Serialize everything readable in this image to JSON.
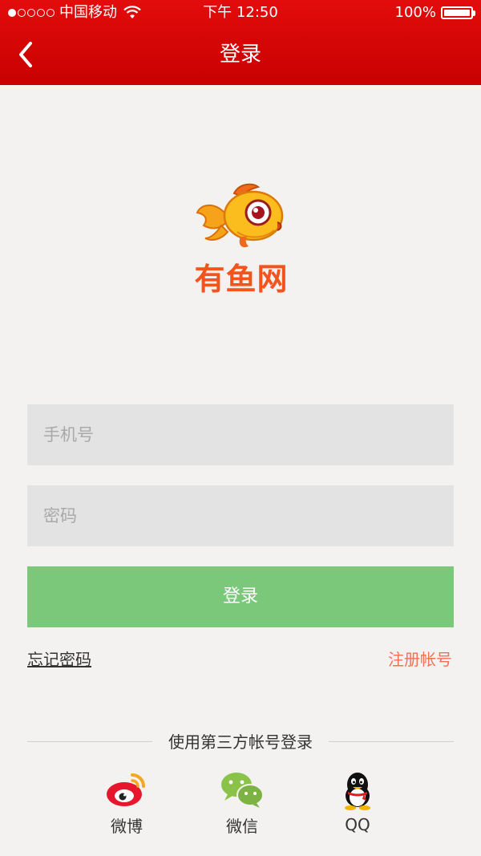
{
  "status_bar": {
    "carrier": "中国移动",
    "time": "下午 12:50",
    "battery": "100%",
    "signal_bars_filled": 1,
    "signal_bars_total": 5
  },
  "nav": {
    "title": "登录",
    "back_icon": "chevron-left-icon"
  },
  "logo": {
    "text": "有鱼网",
    "icon": "fish-mascot-icon",
    "color": "#f3541e"
  },
  "form": {
    "phone_placeholder": "手机号",
    "password_placeholder": "密码",
    "login_label": "登录",
    "forgot_label": "忘记密码",
    "register_label": "注册帐号"
  },
  "third_party": {
    "title": "使用第三方帐号登录",
    "items": [
      {
        "label": "微博",
        "icon": "weibo-icon"
      },
      {
        "label": "微信",
        "icon": "wechat-icon"
      },
      {
        "label": "QQ",
        "icon": "qq-icon"
      }
    ]
  },
  "colors": {
    "nav_bg": "#d80606",
    "login_button": "#7bc87b",
    "register_link": "#f07155",
    "page_bg": "#f3f2f0"
  }
}
